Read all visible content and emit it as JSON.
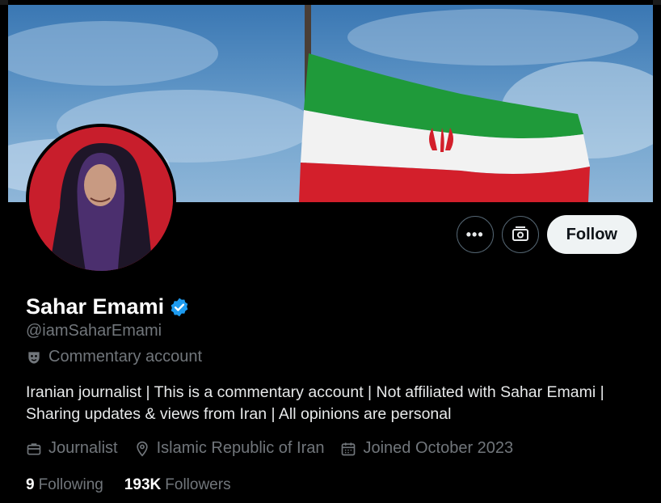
{
  "profile": {
    "name": "Sahar Emami",
    "handle": "@iamSaharEmami",
    "label": "Commentary account",
    "bio_line1": "Iranian journalist | This is a commentary account | Not affiliated with Sahar Emami |",
    "bio_line2": "Sharing updates & views from Iran | All opinions are personal",
    "category": "Journalist",
    "location": "Islamic Republic of Iran",
    "joined": "Joined October 2023",
    "following_count": "9",
    "following_label": "Following",
    "followers_count": "193K",
    "followers_label": "Followers"
  },
  "actions": {
    "more_icon": "more-icon",
    "subscribe_icon": "subscribe-icon",
    "follow_label": "Follow"
  },
  "colors": {
    "background": "#000000",
    "text_primary": "#e7e9ea",
    "text_secondary": "#71767b",
    "verified_blue": "#1d9bf0",
    "follow_button": "#eff3f4"
  }
}
